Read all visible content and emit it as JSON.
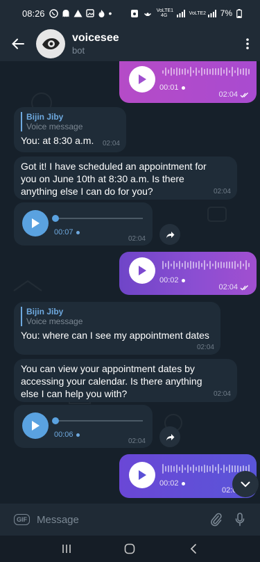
{
  "status_bar": {
    "time": "08:26",
    "battery": "7%",
    "icons": [
      "whatsapp-icon",
      "ghost-icon",
      "alert-icon",
      "gallery-icon",
      "fire-icon",
      "dot-icon",
      "screenshot-icon",
      "hotspot-icon",
      "volte-signal-icon",
      "signal-icon",
      "battery-icon"
    ],
    "lte1": "VoLTE1 4G",
    "lte2": "VoLTE2"
  },
  "header": {
    "title": "voicesee",
    "subtitle": "bot"
  },
  "messages": [
    {
      "type": "voice-out",
      "duration": "00:01",
      "time": "02:04"
    },
    {
      "type": "text-in",
      "quote_name": "Bijin Jiby",
      "quote_text": "Voice message",
      "text": "You: at 8:30 a.m.",
      "time": "02:04"
    },
    {
      "type": "text-in",
      "text": "Got it! I have scheduled an appointment for you on June 10th at 8:30 a.m. Is there anything else I can do for you?",
      "time": "02:04"
    },
    {
      "type": "voice-in",
      "duration": "00:07",
      "time": "02:04"
    },
    {
      "type": "voice-out",
      "duration": "00:02",
      "time": "02:04"
    },
    {
      "type": "text-in",
      "quote_name": "Bijin Jiby",
      "quote_text": "Voice message",
      "text": "You: where can I see my appointment dates",
      "time": "02:04"
    },
    {
      "type": "text-in",
      "text": "You can view your appointment dates by accessing your calendar. Is there anything else I can help you with?",
      "time": "02:04"
    },
    {
      "type": "voice-in",
      "duration": "00:06",
      "time": "02:04"
    },
    {
      "type": "voice-out",
      "duration": "00:02",
      "time": "02:0"
    }
  ],
  "input": {
    "gif_label": "GIF",
    "placeholder": "Message"
  },
  "colors": {
    "accent": "#6ea9df",
    "outgoing_bubble": "#8b4ed2",
    "incoming_bubble": "#1f2c38",
    "background": "#16202a"
  }
}
